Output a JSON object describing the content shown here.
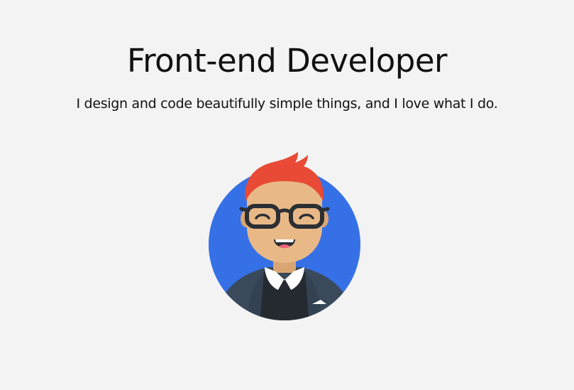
{
  "hero": {
    "title": "Front-end Developer",
    "subtitle": "I design and code beautifully simple things, and I love what I do."
  },
  "avatar": {
    "icon": "developer-avatar-icon",
    "colors": {
      "circle": "#3670e6",
      "hair": "#e84a35",
      "skin": "#e8b987",
      "glasses": "#2b2f33",
      "jacket": "#3a4a5a",
      "shirt": "#252a30",
      "collar": "#ffffff",
      "background": "#f3f3f3"
    }
  }
}
